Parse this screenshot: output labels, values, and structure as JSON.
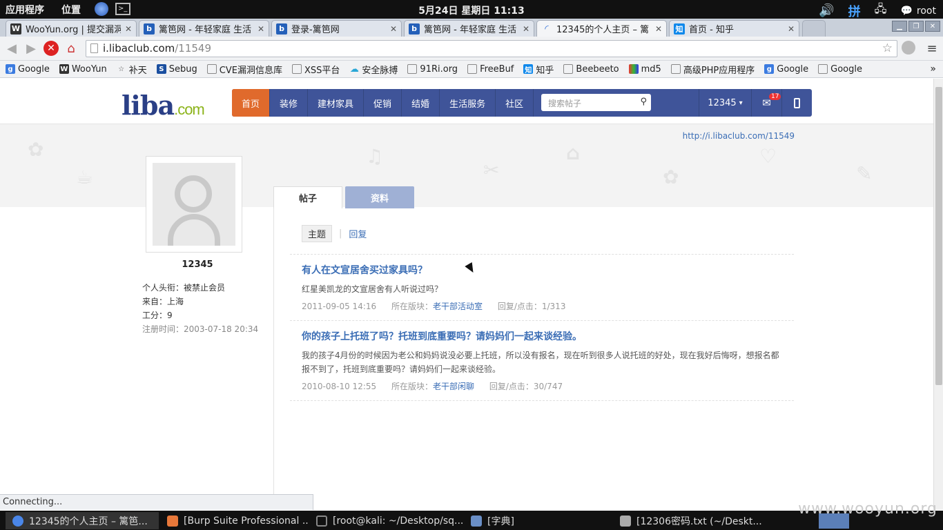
{
  "system": {
    "menu_apps": "应用程序",
    "menu_places": "位置",
    "clock": "5月24日 星期日 11:13",
    "ime": "拼",
    "user": "root"
  },
  "browser": {
    "tabs": [
      {
        "title": "WooYun.org | 提交漏洞",
        "icon": "wooyun-icon"
      },
      {
        "title": "篱笆网 - 年轻家庭 生活",
        "icon": "liba-icon"
      },
      {
        "title": "登录-篱笆网",
        "icon": "liba-icon"
      },
      {
        "title": "篱笆网 - 年轻家庭 生活",
        "icon": "liba-icon"
      },
      {
        "title": "12345的个人主页 – 篱",
        "icon": "loading-icon"
      },
      {
        "title": "首页 - 知乎",
        "icon": "zhihu-icon"
      }
    ],
    "url_host": "i.libaclub.com",
    "url_path": "/11549",
    "bookmarks": [
      "Google",
      "WooYun",
      "补天",
      "Sebug",
      "CVE漏洞信息库",
      "XSS平台",
      "安全脉搏",
      "91Ri.org",
      "FreeBuf",
      "知乎",
      "Beebeeto",
      "md5",
      "高级PHP应用程序",
      "Google",
      "Google"
    ],
    "status": "Connecting..."
  },
  "site": {
    "logo_main": "liba",
    "logo_suffix": ".com",
    "nav": [
      "首页",
      "装修",
      "建材家具",
      "促销",
      "结婚",
      "生活服务",
      "社区"
    ],
    "search_placeholder": "搜索帖子",
    "user_menu": "12345",
    "mail_count": "17",
    "profile_url": "http://i.libaclub.com/11549"
  },
  "profile": {
    "username": "12345",
    "title_line": "个人头衔：被禁止会员",
    "from_line": "来自：上海",
    "points_line": "工分：9",
    "reg_line": "注册时间：2003-07-18 20:34"
  },
  "tabs": {
    "posts": "帖子",
    "info": "资料"
  },
  "subtabs": {
    "topics": "主题",
    "replies": "回复"
  },
  "posts": [
    {
      "title": "有人在文宣居舍买过家具吗？",
      "body": "红星美凯龙的文宣居舍有人听说过吗？",
      "date": "2011-09-05 14:16",
      "board_label": "所在版块：",
      "board": "老干部活动室",
      "stats": "回复/点击：1/313"
    },
    {
      "title": "你的孩子上托班了吗？托班到底重要吗？请妈妈们一起来谈经验。",
      "body": "我的孩子4月份的时候因为老公和妈妈说没必要上托班，所以没有报名，现在听到很多人说托班的好处，现在我好后悔呀，想报名都报不到了，托班到底重要吗？请妈妈们一起来谈经验。",
      "date": "2010-08-10 12:55",
      "board_label": "所在版块：",
      "board": "老干部闲聊",
      "stats": "回复/点击：30/747"
    }
  ],
  "taskbar": [
    "12345的个人主页 – 篱笆...",
    "[Burp Suite Professional ...",
    "[root@kali: ~/Desktop/sq...",
    "[字典]",
    "[12306密码.txt (~/Deskt..."
  ],
  "watermark": "www.wooyun.org"
}
